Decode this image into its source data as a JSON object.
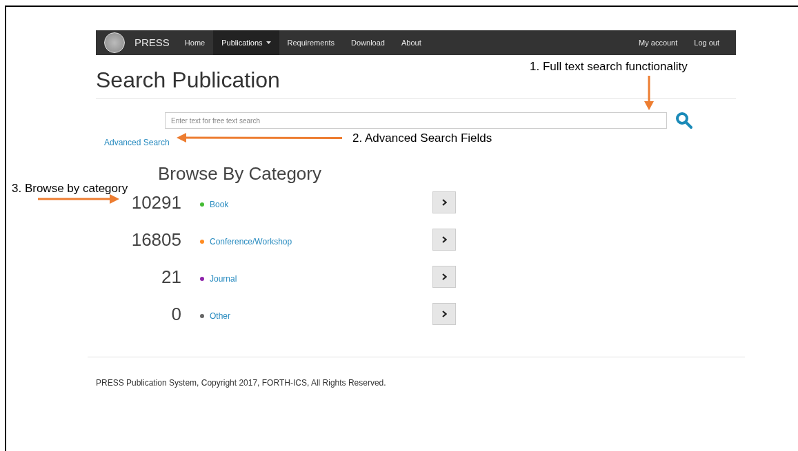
{
  "navbar": {
    "brand": "PRESS",
    "items": [
      {
        "label": "Home",
        "selected": false,
        "dropdown": false
      },
      {
        "label": "Publications",
        "selected": true,
        "dropdown": true
      },
      {
        "label": "Requirements",
        "selected": false,
        "dropdown": false
      },
      {
        "label": "Download",
        "selected": false,
        "dropdown": false
      },
      {
        "label": "About",
        "selected": false,
        "dropdown": false
      }
    ],
    "right_items": [
      "My account",
      "Log out"
    ]
  },
  "title": "Search Publication",
  "search": {
    "placeholder": "Enter text for free text search"
  },
  "advanced_search_link": "Advanced Search",
  "browse": {
    "heading": "Browse By Category",
    "categories": [
      {
        "count": "10291",
        "label": "Book",
        "color": "#44bb33"
      },
      {
        "count": "16805",
        "label": "Conference/Workshop",
        "color": "#ff8c22"
      },
      {
        "count": "21",
        "label": "Journal",
        "color": "#8e24aa"
      },
      {
        "count": "0",
        "label": "Other",
        "color": "#666666"
      }
    ]
  },
  "footer": "PRESS Publication System, Copyright 2017, FORTH-ICS, All Rights Reserved.",
  "annotations": [
    {
      "text": "1. Full text search functionality",
      "kind": "down"
    },
    {
      "text": "2. Advanced Search Fields",
      "kind": "left"
    },
    {
      "text": "3. Browse by category",
      "kind": "right"
    }
  ]
}
